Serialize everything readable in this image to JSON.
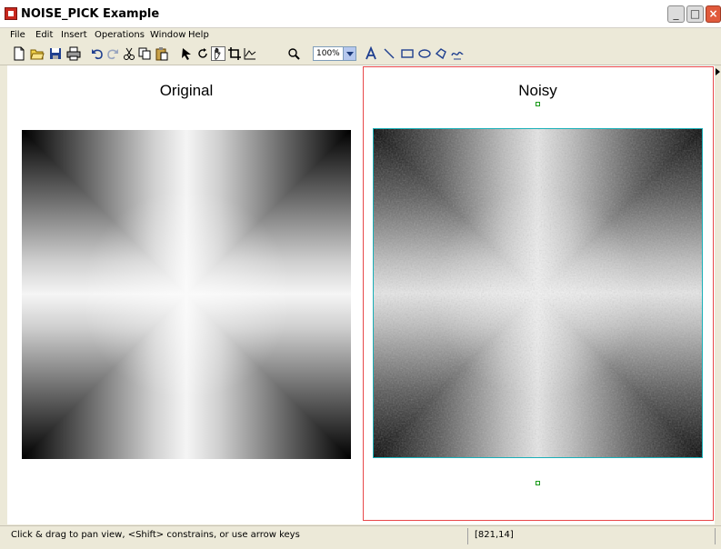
{
  "window": {
    "title": "NOISE_PICK Example",
    "minimize_icon": "minimize-icon",
    "maximize_icon": "maximize-icon",
    "close_icon": "close-icon"
  },
  "menu": {
    "items": [
      "File",
      "Edit",
      "Insert",
      "Operations",
      "Window",
      "Help"
    ]
  },
  "toolbar": {
    "icons": [
      "new-file-icon",
      "open-folder-icon",
      "save-icon",
      "print-icon",
      "undo-icon",
      "redo-icon",
      "cut-icon",
      "copy-icon",
      "paste-icon",
      "select-arrow-icon",
      "rotate-icon",
      "pan-hand-icon",
      "crop-icon",
      "data-cursor-icon",
      "zoom-icon",
      "text-icon",
      "line-icon",
      "rectangle-icon",
      "ellipse-icon",
      "polygon-icon",
      "freehand-icon"
    ],
    "zoom": "100%",
    "active_tool": "pan-hand-icon"
  },
  "figure": {
    "left_title": "Original",
    "right_title": "Noisy",
    "colors": {
      "selection": "#e8484a",
      "axes_highlight": "#1ab0b8",
      "handle": "#1a9a1a"
    }
  },
  "status": {
    "message": "Click & drag to pan view, <Shift> constrains, or use arrow keys",
    "coords": "[821,14]"
  }
}
